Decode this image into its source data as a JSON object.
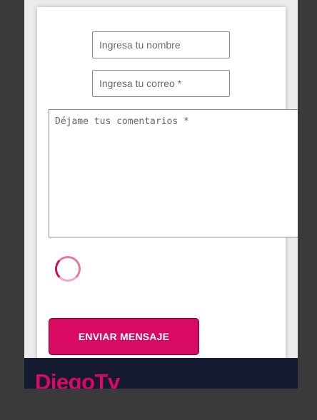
{
  "colors": {
    "accent": "#d90a62",
    "footer_bg": "#161a30",
    "outer_bg": "#3a3a3a"
  },
  "form": {
    "name_placeholder": "Ingresa tu nombre",
    "email_placeholder": "Ingresa tu correo *",
    "comments_placeholder": "Déjame tus comentarios *",
    "loading_indicator_icon": "spinner-icon",
    "submit_label": "ENVIAR MENSAJE"
  },
  "footer": {
    "brand": "DiegoTv"
  }
}
